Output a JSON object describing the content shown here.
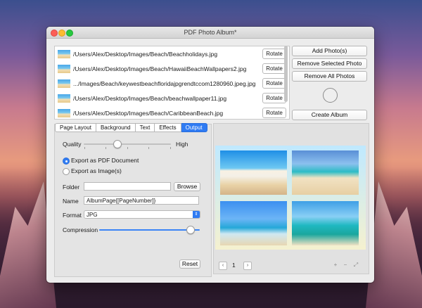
{
  "window": {
    "title": "PDF Photo Album*"
  },
  "files": [
    {
      "path": "/Users/Alex/Desktop/Images/Beach/Beachholidays.jpg",
      "action": "Rotate"
    },
    {
      "path": "/Users/Alex/Desktop/Images/Beach/HawaiiBeachWallpapers2.jpg",
      "action": "Rotate"
    },
    {
      "path": ".../Images/Beach/keywestbeachfloridajpgrendtccom1280960.jpeg.jpg",
      "action": "Rotate"
    },
    {
      "path": "/Users/Alex/Desktop/Images/Beach/beachwallpaper11.jpg",
      "action": "Rotate"
    },
    {
      "path": "/Users/Alex/Desktop/Images/Beach/CaribbeanBeach.jpg",
      "action": "Rotate"
    }
  ],
  "side_buttons": {
    "add": "Add Photo(s)",
    "remove_selected": "Remove Selected Photo",
    "remove_all": "Remove All Photos",
    "create": "Create Album"
  },
  "tabs": [
    "Page Layout",
    "Background",
    "Text",
    "Effects",
    "Output"
  ],
  "active_tab": "Output",
  "output": {
    "quality_label": "Quality",
    "quality_high": "High",
    "quality_level": 0.38,
    "export_pdf": "Export as PDF Document",
    "export_images": "Export as Image(s)",
    "export_selected": "pdf",
    "folder_label": "Folder",
    "folder_value": "",
    "browse": "Browse",
    "name_label": "Name",
    "name_value": "AlbumPage{[PageNumber]}",
    "format_label": "Format",
    "format_value": "JPG",
    "compression_label": "Compression",
    "compression_level": 0.9,
    "reset": "Reset"
  },
  "preview": {
    "page_number": "1"
  },
  "icons": {
    "prev": "chevron-left-icon",
    "next": "chevron-right-icon",
    "zoom_in": "plus-icon",
    "zoom_out": "minus-icon",
    "fit": "expand-icon"
  }
}
